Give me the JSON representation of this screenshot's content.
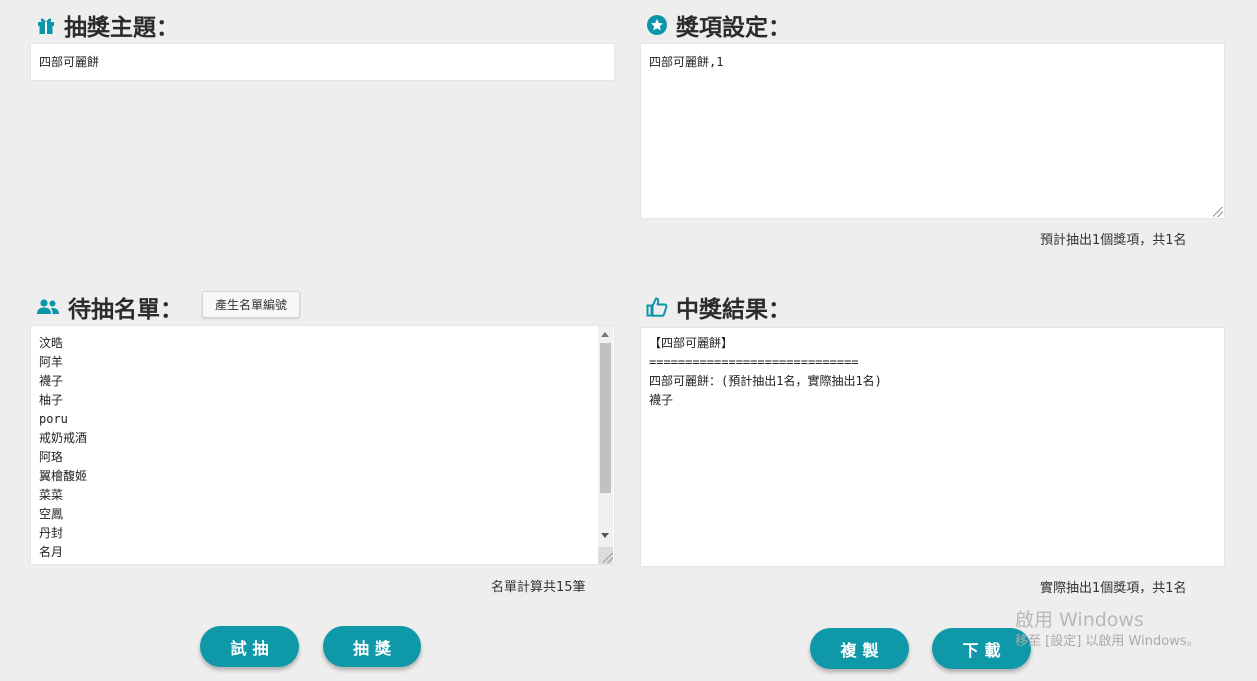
{
  "theme_section": {
    "title": "抽獎主題：",
    "icon": "gift-icon",
    "value": "四部可麗餅"
  },
  "prize_section": {
    "title": "獎項設定：",
    "icon": "star-circle-icon",
    "value": "四部可麗餅,1",
    "summary": "預計抽出1個獎項，共1名"
  },
  "list_section": {
    "title": "待抽名單：",
    "icon": "users-icon",
    "generate_button": "產生名單編號",
    "names": "汶晧\n阿羊\n襪子\n柚子\nporu\n戒奶戒酒\n阿珞\n翼檜馥姬\n菜菜\n空鳳\n丹封\n名月",
    "summary": "名單計算共15筆"
  },
  "result_section": {
    "title": "中獎結果：",
    "icon": "thumbs-up-icon",
    "value": "【四部可麗餅】\n=============================\n四部可麗餅：(預計抽出1名，實際抽出1名)\n襪子",
    "summary": "實際抽出1個獎項，共1名"
  },
  "buttons": {
    "trial": "試抽",
    "draw": "抽獎",
    "copy": "複製",
    "download": "下載"
  },
  "watermark": {
    "line1": "啟用 Windows",
    "line2": "移至 [設定] 以啟用 Windows。"
  },
  "colors": {
    "accent": "#0e98a8",
    "background": "#eeeeee"
  }
}
